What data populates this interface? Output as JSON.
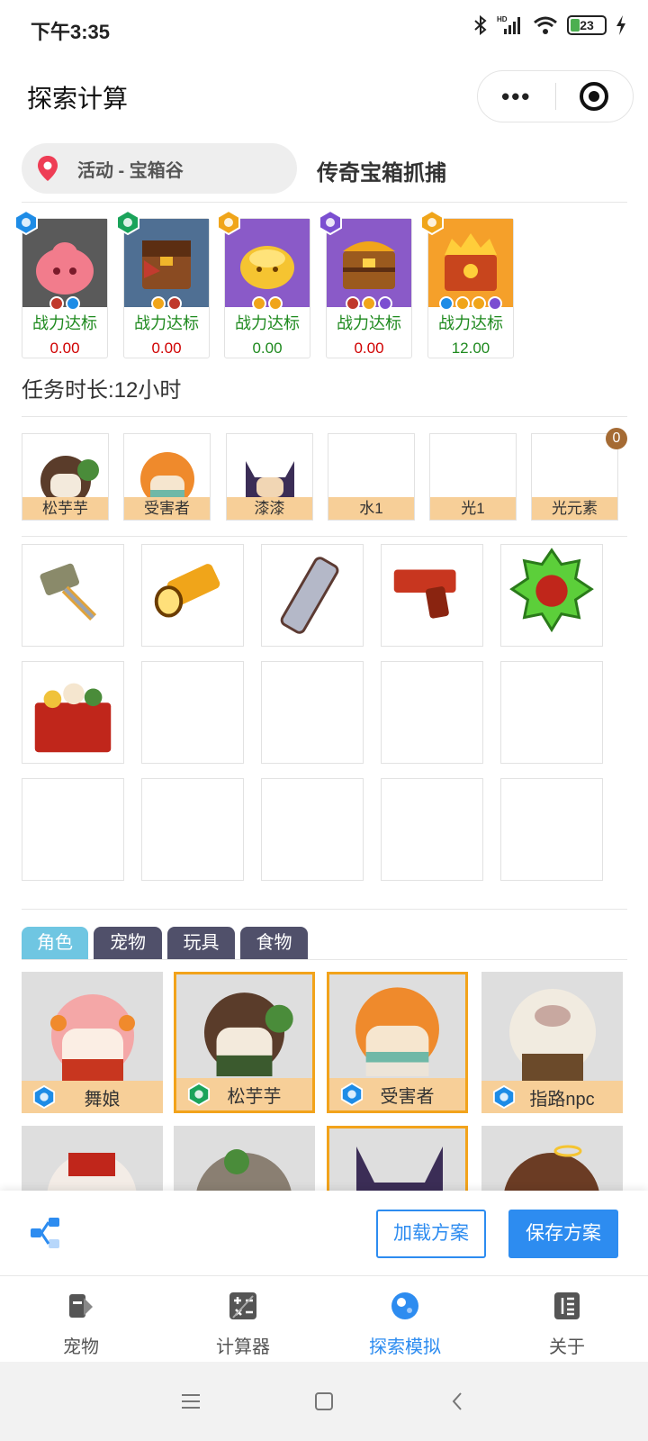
{
  "status_bar": {
    "time": "下午3:35",
    "battery": "23"
  },
  "nav": {
    "title": "探索计算",
    "more_label": "•••"
  },
  "location": {
    "area": "活动 - 宝箱谷",
    "target": "传奇宝箱抓捕"
  },
  "enemies": [
    {
      "status": "战力达标",
      "value": "0.00",
      "value_color": "#d00000",
      "bg": "#5a5a5a",
      "rarity": "water"
    },
    {
      "status": "战力达标",
      "value": "0.00",
      "value_color": "#d00000",
      "bg": "#4f6f93",
      "rarity": "leaf"
    },
    {
      "status": "战力达标",
      "value": "0.00",
      "value_color": "#1f8a1f",
      "bg": "#8a5ac8",
      "rarity": "light"
    },
    {
      "status": "战力达标",
      "value": "0.00",
      "value_color": "#d00000",
      "bg": "#8a5ac8",
      "rarity": "dark"
    },
    {
      "status": "战力达标",
      "value": "12.00",
      "value_color": "#1f8a1f",
      "bg": "#f5a02a",
      "rarity": "light"
    }
  ],
  "duration": "任务时长:12小时",
  "team": {
    "count": "0",
    "slots": [
      {
        "label": "松芋芋"
      },
      {
        "label": "受害者"
      },
      {
        "label": "漆漆"
      },
      {
        "label": "水1"
      },
      {
        "label": "光1"
      },
      {
        "label": "光元素"
      }
    ]
  },
  "items": [
    {
      "icon": "hammer-icon"
    },
    {
      "icon": "flashlight-icon"
    },
    {
      "icon": "ruler-icon"
    },
    {
      "icon": "flare-gun-icon"
    },
    {
      "icon": "medal-icon"
    },
    {
      "icon": "food-box-icon"
    }
  ],
  "tabs": [
    {
      "label": "角色"
    },
    {
      "label": "宠物"
    },
    {
      "label": "玩具"
    },
    {
      "label": "食物"
    }
  ],
  "roster": [
    {
      "name": "舞娘",
      "rarity": "water"
    },
    {
      "name": "松芋芋",
      "rarity": "leaf"
    },
    {
      "name": "受害者",
      "rarity": "water"
    },
    {
      "name": "指路npc",
      "rarity": "water"
    }
  ],
  "actions": {
    "load": "加载方案",
    "save": "保存方案"
  },
  "tabbar": [
    {
      "label": "宠物"
    },
    {
      "label": "计算器"
    },
    {
      "label": "探索模拟"
    },
    {
      "label": "关于"
    }
  ],
  "colors": {
    "accent": "#2d8cf0",
    "label_bg": "#f7cf98",
    "selected_border": "#f2a31b"
  }
}
